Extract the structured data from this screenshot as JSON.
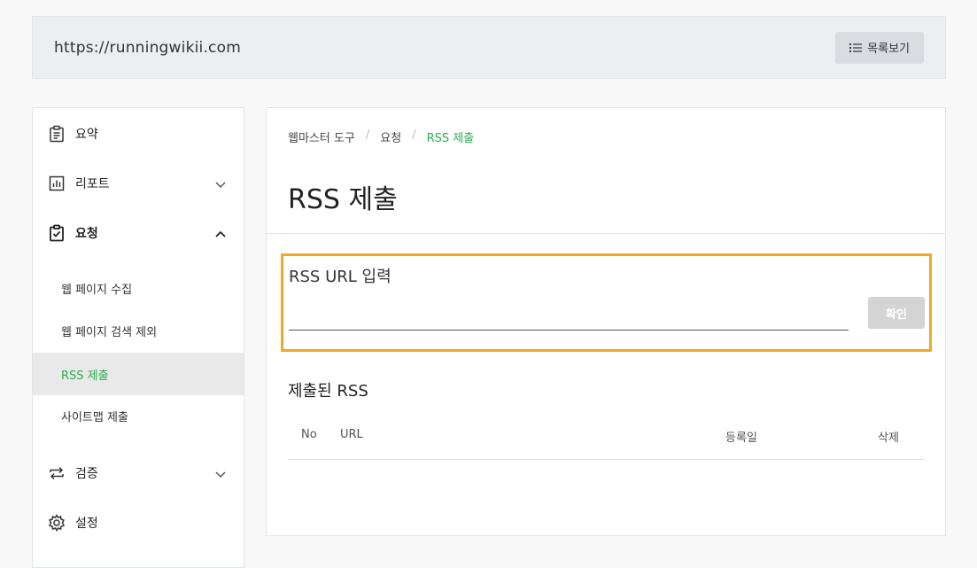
{
  "site": {
    "url": "https://runningwikii.com",
    "list_button": "목록보기",
    "list_icon": "list-icon"
  },
  "sidebar": {
    "items": [
      {
        "label": "요약",
        "icon": "clipboard-icon"
      },
      {
        "label": "리포트",
        "icon": "chart-icon",
        "expanded": false
      },
      {
        "label": "요청",
        "icon": "clipboard-check-icon",
        "expanded": true,
        "children": [
          {
            "label": "웹 페이지 수집"
          },
          {
            "label": "웹 페이지 검색 제외"
          },
          {
            "label": "RSS 제출",
            "active": true
          },
          {
            "label": "사이트맵 제출"
          }
        ]
      },
      {
        "label": "검증",
        "icon": "repeat-icon",
        "expanded": false
      },
      {
        "label": "설정",
        "icon": "gear-icon"
      }
    ]
  },
  "breadcrumb": [
    "웹마스터 도구",
    "요청",
    "RSS 제출"
  ],
  "page": {
    "title": "RSS 제출",
    "input_label": "RSS URL 입력",
    "input_value": "",
    "confirm_button": "확인",
    "submitted_title": "제출된 RSS",
    "table_columns": [
      "No",
      "URL",
      "등록일",
      "삭제"
    ]
  },
  "colors": {
    "accent_green": "#27b04f",
    "highlight_orange": "#f5a623",
    "disabled_button": "#d4d4d4"
  }
}
